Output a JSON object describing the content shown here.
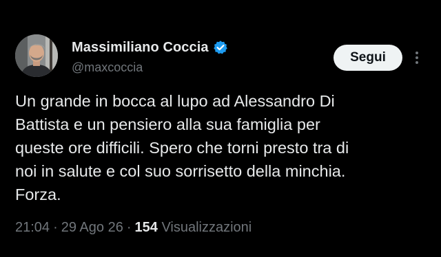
{
  "author": {
    "display_name": "Massimiliano Coccia",
    "handle": "@maxcoccia",
    "verified": true,
    "avatar_icon": "profile-photo"
  },
  "actions": {
    "follow_label": "Segui",
    "more_icon": "more-vertical-icon"
  },
  "tweet": {
    "lines": [
      "Un grande in bocca al lupo ad Alessandro Di",
      "Battista e un pensiero alla sua famiglia per",
      "queste ore difficili. Spero che torni presto tra di",
      "noi in salute e col suo sorrisetto della minchia.",
      "Forza."
    ]
  },
  "meta": {
    "time": "21:04",
    "separator": "·",
    "date": "29 Ago 26",
    "views_count": "154",
    "views_label": "Visualizzazioni"
  },
  "colors": {
    "background": "#000000",
    "text_primary": "#e7e9ea",
    "text_secondary": "#71767b",
    "verified_badge": "#1d9bf0",
    "follow_button_bg": "#eff3f4"
  }
}
